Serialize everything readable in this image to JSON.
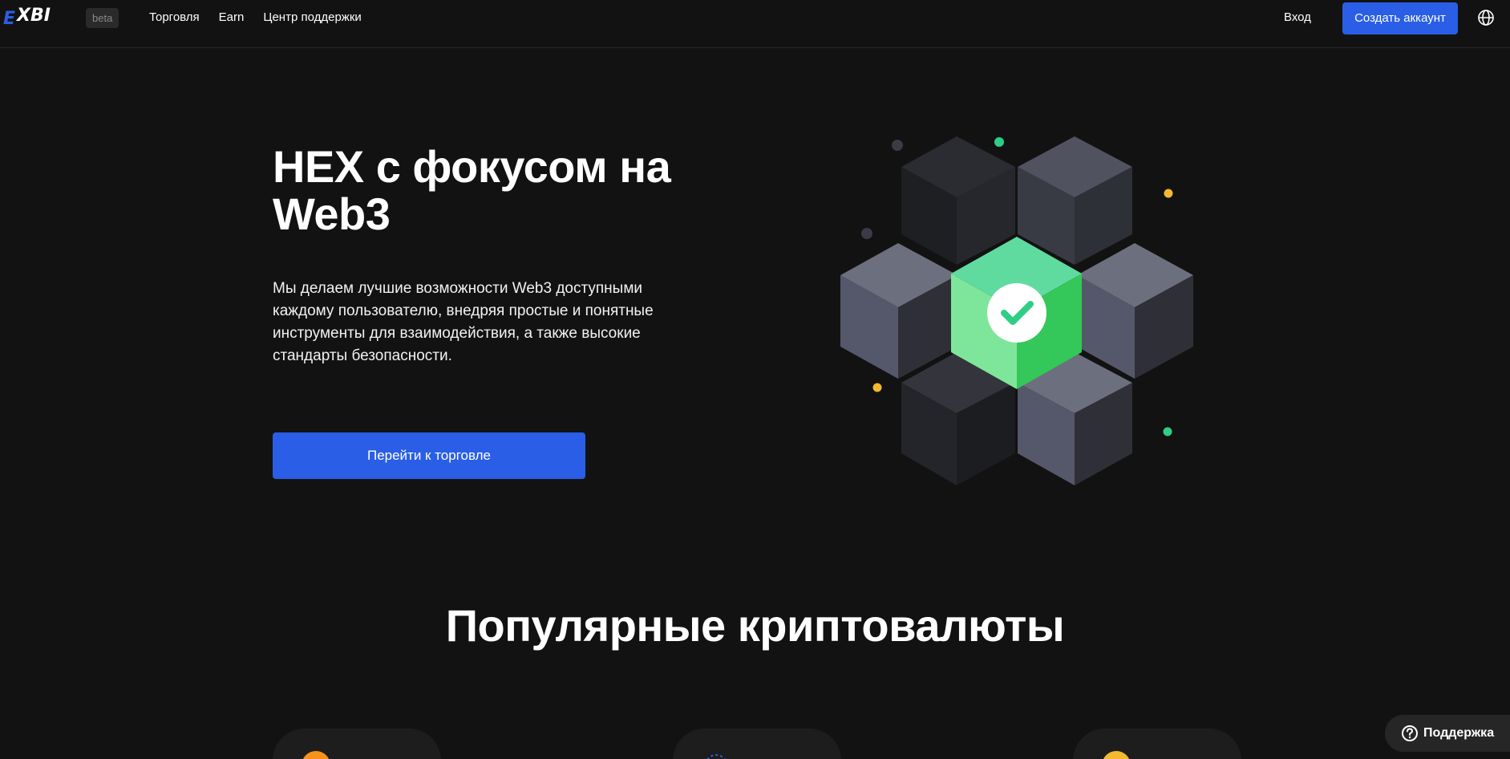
{
  "header": {
    "logo_alt": "EXBI",
    "beta": "beta",
    "nav": [
      {
        "label": "Торговля"
      },
      {
        "label": "Earn"
      },
      {
        "label": "Центр поддержки"
      }
    ],
    "login": "Вход",
    "signup": "Создать аккаунт",
    "language_icon": "globe-icon"
  },
  "hero": {
    "title": "HEX с фокусом на Web3",
    "description": "Мы делаем лучшие возможности Web3 доступными каждому пользователю, внедряя простые и понятные инструменты для взаимодействия, а также высокие стандарты безопасности.",
    "cta": "Перейти к торговле",
    "illustration_icon": "cubes-check-icon"
  },
  "popular": {
    "title": "Популярные криптовалюты",
    "cards": [
      {
        "icon": "bitcoin-icon",
        "color": "#f7931a"
      },
      {
        "icon": "coin-icon",
        "color": "#2a5ee6"
      },
      {
        "icon": "bnb-icon",
        "color": "#f3ba2f"
      }
    ]
  },
  "support": {
    "label": "Поддержка",
    "icon": "question-icon"
  },
  "colors": {
    "background": "#121212",
    "accent": "#2a5ee6",
    "green": "#34c759",
    "yellow": "#f3ba2f"
  }
}
